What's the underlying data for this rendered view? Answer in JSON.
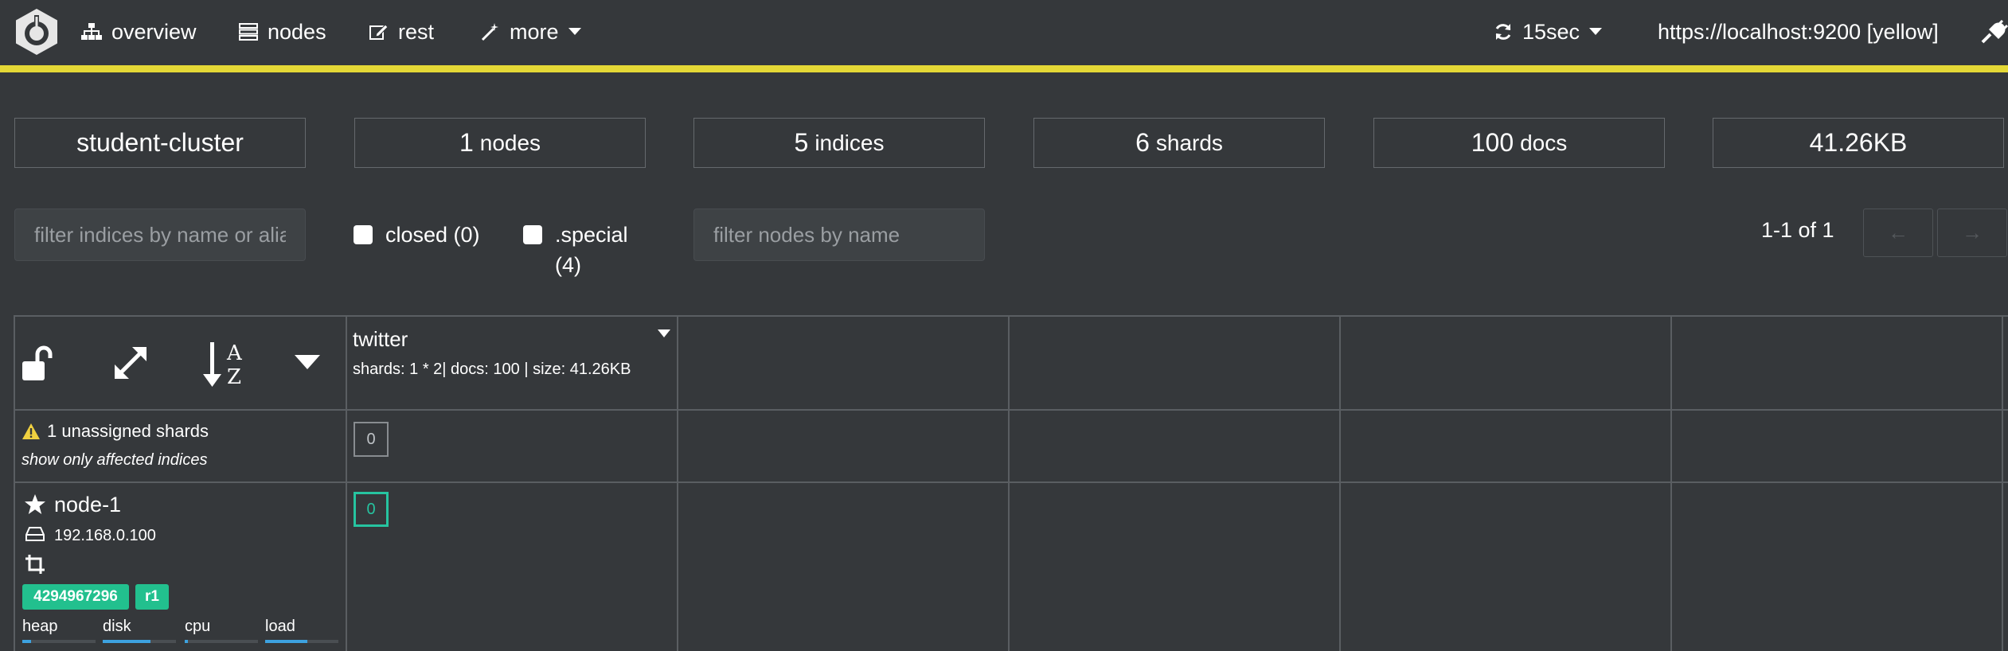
{
  "nav": {
    "items": [
      {
        "label": "overview",
        "icon": "sitemap-icon"
      },
      {
        "label": "nodes",
        "icon": "server-icon"
      },
      {
        "label": "rest",
        "icon": "edit-icon"
      },
      {
        "label": "more",
        "icon": "magic-wand-icon"
      }
    ],
    "refresh": "15sec",
    "connection": "https://localhost:9200 [yellow]"
  },
  "colors": {
    "background": "#35383b",
    "status_bar": "#e4d836",
    "shard_green": "#26c4a0",
    "badge_green": "#22c08e",
    "metric_blue": "#3da2e0"
  },
  "summary": {
    "cluster": "student-cluster",
    "nodes_num": "1",
    "nodes_label": "nodes",
    "indices_num": "5",
    "indices_label": "indices",
    "shards_num": "6",
    "shards_label": "shards",
    "docs_num": "100",
    "docs_label": "docs",
    "size": "41.26KB"
  },
  "filters": {
    "indices_placeholder": "filter indices by name or aliases",
    "closed_label": "closed (0)",
    "special_label": ".special",
    "special_count": "(4)",
    "nodes_placeholder": "filter nodes by name",
    "pager": "1-1 of 1",
    "prev": "←",
    "next": "→"
  },
  "index": {
    "name": "twitter",
    "info": "shards: 1 * 2| docs: 100 | size: 41.26KB"
  },
  "unassigned": {
    "text": "1 unassigned shards",
    "link": "show only affected indices",
    "shard": "0"
  },
  "node": {
    "name": "node-1",
    "ip": "192.168.0.100",
    "badge_id": "4294967296",
    "badge_role": "r1",
    "shard": "0",
    "metrics": [
      {
        "label": "heap",
        "fill": 0.12
      },
      {
        "label": "disk",
        "fill": 0.65
      },
      {
        "label": "cpu",
        "fill": 0.04
      },
      {
        "label": "load",
        "fill": 0.58
      }
    ]
  }
}
